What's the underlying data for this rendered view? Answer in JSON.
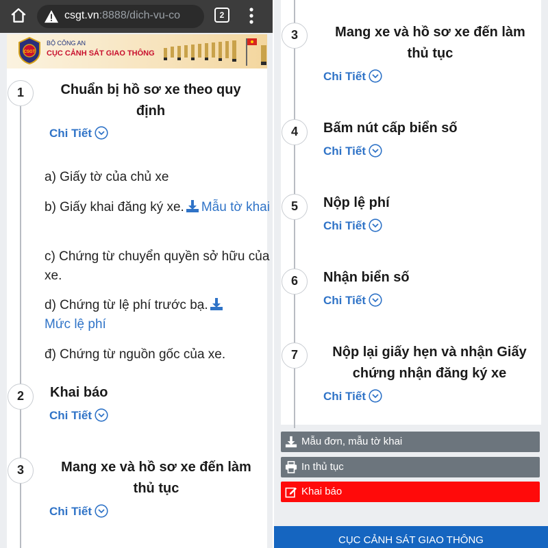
{
  "browser": {
    "url_host": "csgt.vn",
    "url_path": ":8888/dich-vu-co",
    "tab_count": "2",
    "icons": {
      "home": "home-icon",
      "warning": "warning-icon",
      "tabs": "tabs-icon",
      "menu": "more-vert-icon"
    }
  },
  "site": {
    "ministry": "BỘ CÔNG AN",
    "agency": "CỤC CẢNH SÁT GIAO THÔNG",
    "logo_text": "CSGT"
  },
  "left": {
    "steps": [
      {
        "num": "1",
        "title": "Chuẩn bị hồ sơ xe theo quy định",
        "detail": "Chi Tiết"
      },
      {
        "num": "2",
        "title": "Khai báo",
        "detail": "Chi Tiết"
      },
      {
        "num": "3",
        "title": "Mang xe và hồ sơ xe đến làm thủ tục",
        "detail": "Chi Tiết"
      }
    ],
    "documents": {
      "a": "a) Giấy tờ của chủ xe",
      "b_text": "b) Giấy khai đăng ký xe.",
      "b_link": "Mẫu tờ khai",
      "c": "c) Chứng từ chuyển quyền sở hữu của xe.",
      "d_text": "d) Chứng từ lệ phí trước bạ.",
      "d_link": "Mức lệ phí",
      "e": "đ) Chứng từ nguồn gốc của xe."
    }
  },
  "right": {
    "steps": [
      {
        "num": "3",
        "title": "Mang xe và hồ sơ xe đến làm thủ tục",
        "detail": "Chi Tiết"
      },
      {
        "num": "4",
        "title": "Bấm nút cấp biển số",
        "detail": "Chi Tiết"
      },
      {
        "num": "5",
        "title": "Nộp lệ phí",
        "detail": "Chi Tiết"
      },
      {
        "num": "6",
        "title": "Nhận biển số",
        "detail": "Chi Tiết"
      },
      {
        "num": "7",
        "title": "Nộp lại giấy hẹn và nhận Giấy chứng nhận đăng ký xe",
        "detail": "Chi Tiết"
      }
    ],
    "actions": {
      "forms": "Mẫu đơn, mẫu tờ khai",
      "print": "In thủ tục",
      "declare": "Khai báo"
    },
    "footer": "CỤC CẢNH SÁT GIAO THÔNG"
  },
  "colors": {
    "link": "#2f73c7",
    "grey_button": "#6c757d",
    "red_button": "#ff0a0a",
    "footer": "#1565c0"
  }
}
